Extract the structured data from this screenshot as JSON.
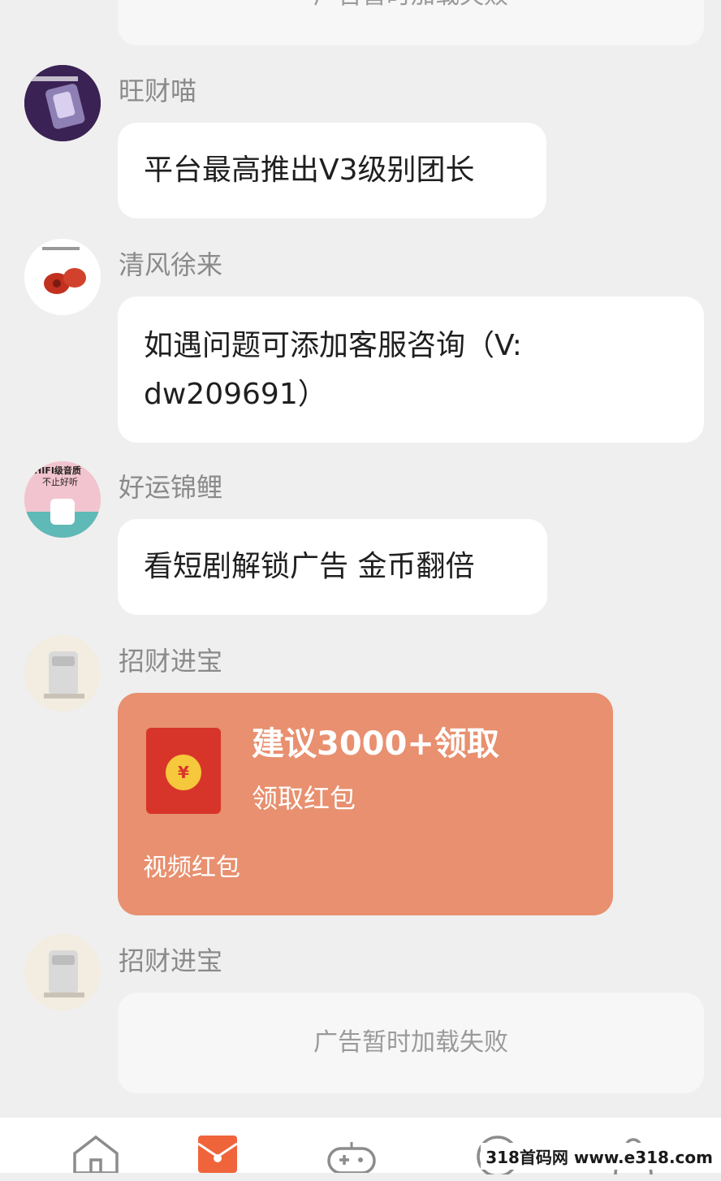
{
  "messages": [
    {
      "type": "ad_failed",
      "text": "广告暂时加载失败"
    },
    {
      "type": "text",
      "sender": "旺财喵",
      "text": "平台最高推出V3级别团长"
    },
    {
      "type": "text",
      "sender": "清风徐来",
      "text_line1": "如遇问题可添加客服咨询（V:",
      "text_line2": "dw209691）"
    },
    {
      "type": "text",
      "sender": "好运锦鲤",
      "text": "看短剧解锁广告 金币翻倍",
      "avatar_caption_1": "HIFI级音质",
      "avatar_caption_2": "不止好听"
    },
    {
      "type": "red_packet",
      "sender": "招财进宝",
      "title": "建议3000+领取",
      "subtitle": "领取红包",
      "footer": "视频红包",
      "coin_symbol": "¥"
    },
    {
      "type": "ad_failed",
      "sender": "招财进宝",
      "text": "广告暂时加载失败"
    }
  ],
  "tabbar": {
    "icons": [
      "home-icon",
      "red-envelope-icon",
      "gamepad-icon",
      "coin-icon",
      "profile-icon"
    ],
    "active_color": "#f0643c"
  },
  "watermark": "318首码网 www.e318.com",
  "colors": {
    "background": "#efefef",
    "red_packet": "#e8906f",
    "bubble": "#ffffff"
  }
}
